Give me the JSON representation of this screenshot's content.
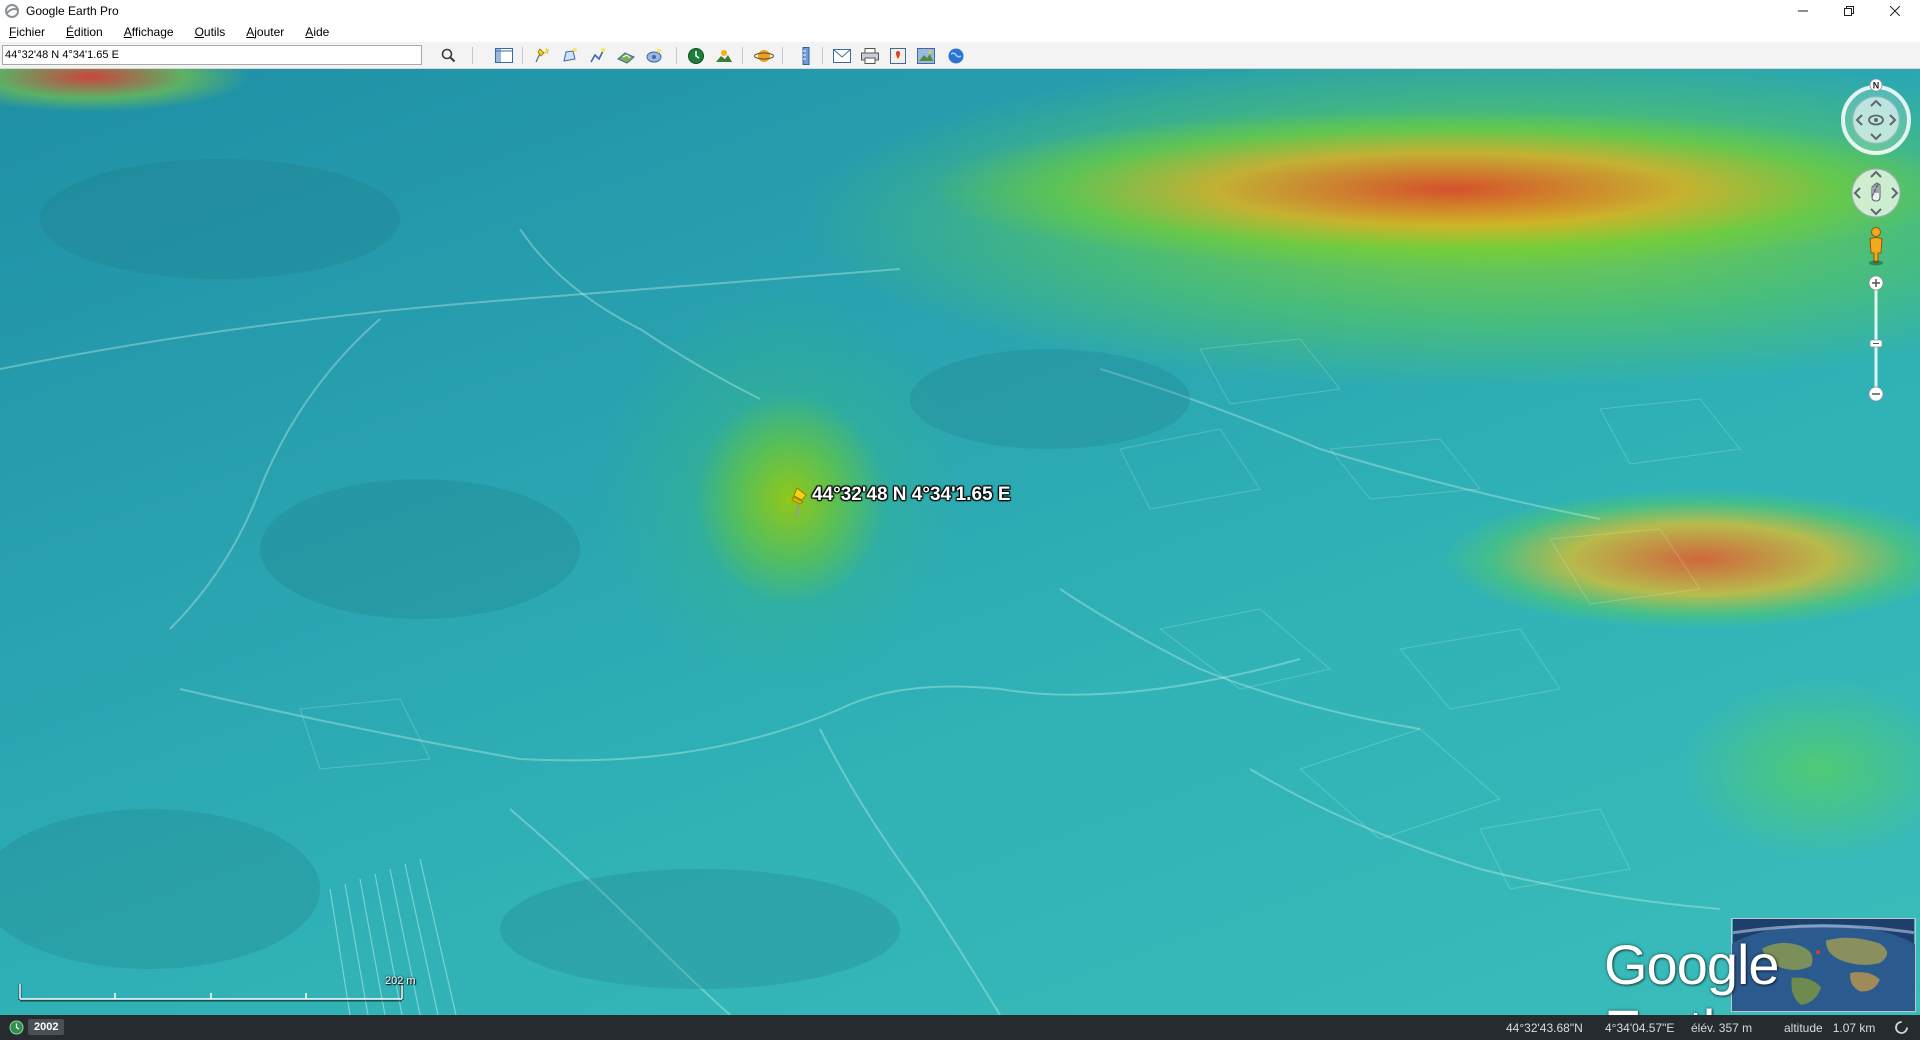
{
  "window": {
    "title": "Google Earth Pro",
    "minimize_icon": "minimize-icon",
    "restore_icon": "restore-icon",
    "close_icon": "close-icon"
  },
  "menu": [
    "Fichier",
    "Édition",
    "Affichage",
    "Outils",
    "Ajouter",
    "Aide"
  ],
  "search": {
    "value": "44°32'48 N 4°34'1.65 E",
    "button_icon": "search-icon"
  },
  "toolbar": {
    "icons": [
      "sidebar-toggle-icon",
      "add-placemark-icon",
      "add-polygon-icon",
      "add-path-icon",
      "add-image-overlay-icon",
      "record-tour-icon",
      "historical-imagery-icon",
      "sunlight-icon",
      "switch-planet-icon",
      "ruler-icon",
      "email-icon",
      "print-icon",
      "save-image-icon",
      "google-maps-icon",
      "earth-gallery-icon"
    ]
  },
  "map": {
    "placemark_label": "44°32'48 N 4°34'1.65 E",
    "placemark_icon": "yellow-pushpin-icon",
    "compass_letter": "N",
    "scale_label": "202 m",
    "logo": "Google Earth"
  },
  "status": {
    "imagery_year": "2002",
    "latitude": "44°32'43.68\"N",
    "longitude": "4°34'04.57\"E",
    "elevation": "élév.  357 m",
    "altitude": "altitude   1.07 km"
  },
  "colors": {
    "status_bar_bg": "#262b30",
    "toolbar_bg": "#f3f3f3",
    "terrain_low": "#29a3b0",
    "terrain_mid": "#8fd23a",
    "terrain_high": "#e8452f",
    "pin_yellow": "#f6d21a"
  }
}
